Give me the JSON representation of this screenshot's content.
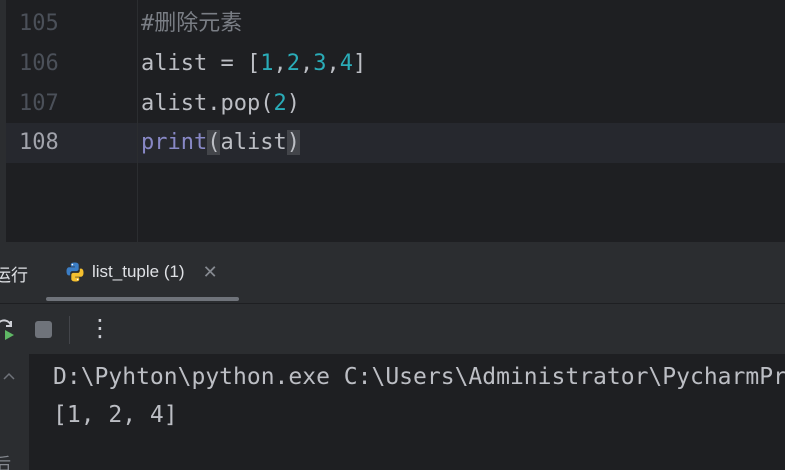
{
  "editor": {
    "lines": [
      {
        "number": "105",
        "text": "#删除元素"
      },
      {
        "number": "106",
        "prefix": "alist = [",
        "n1": "1",
        "n2": "2",
        "n3": "3",
        "n4": "4",
        "suffix": "]"
      },
      {
        "number": "107",
        "prefix": "alist.pop(",
        "arg": "2",
        "suffix": ")"
      },
      {
        "number": "108",
        "builtin": "print",
        "open": "(",
        "arg": "alist",
        "close": ")"
      }
    ]
  },
  "tool_window": {
    "title": "运行",
    "tab_label": "list_tuple (1)",
    "tab_close": "✕",
    "more_glyph": "⋮"
  },
  "console": {
    "lines": [
      "D:\\Pyhton\\python.exe C:\\Users\\Administrator\\PycharmPr",
      "[1, 2, 4]"
    ],
    "side_glyph": "后"
  },
  "colors": {
    "editor_bg": "#1e1f22",
    "panel_bg": "#2b2d30",
    "number_literal": "#2aacb8",
    "builtin": "#8888c6",
    "comment": "#7a7e85",
    "text": "#bcbec4"
  }
}
